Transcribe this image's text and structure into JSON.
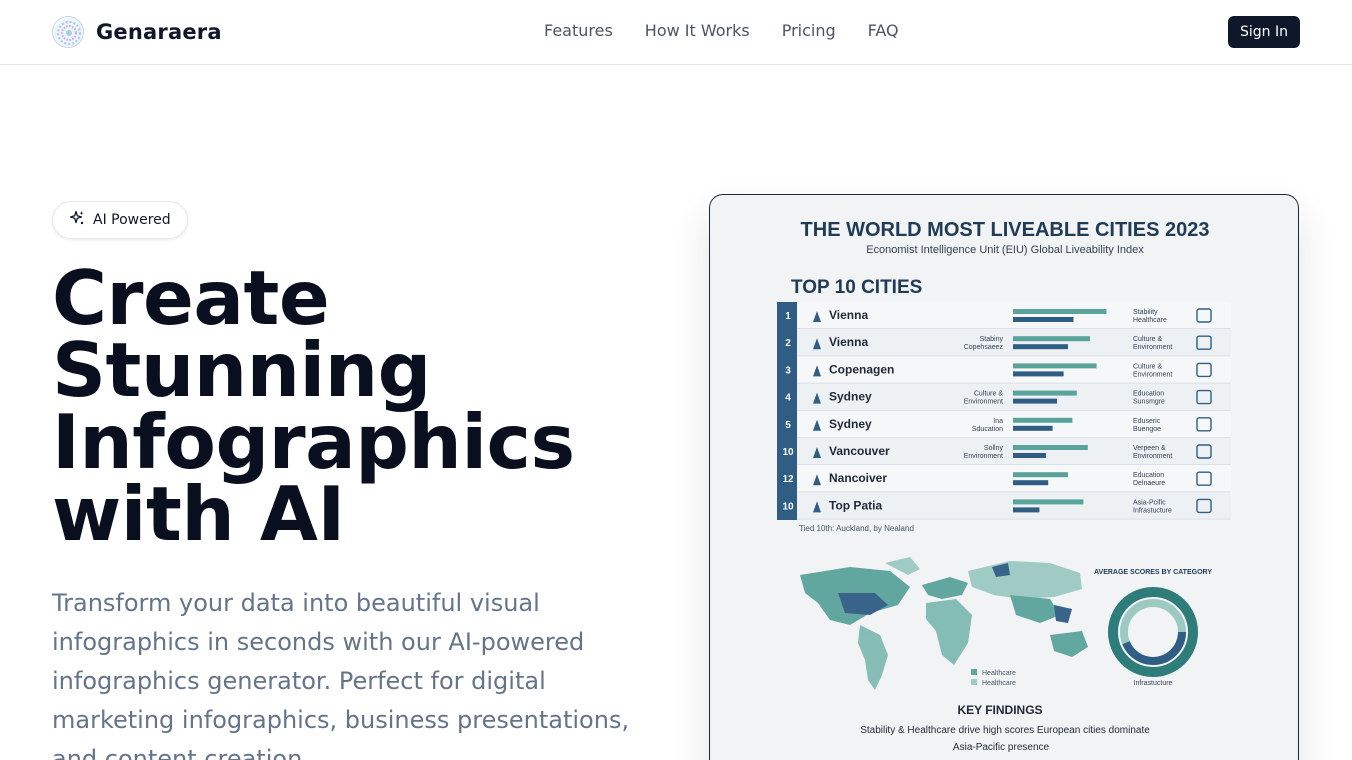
{
  "header": {
    "brand": "Genaraera",
    "nav": [
      "Features",
      "How It Works",
      "Pricing",
      "FAQ"
    ],
    "signin": "Sign In"
  },
  "hero": {
    "badge": "AI Powered",
    "title_lines": [
      "Create",
      "Stunning",
      "Infographics",
      "with AI"
    ],
    "description": "Transform your data into beautiful visual infographics in seconds with our AI-powered infographics generator. Perfect for digital marketing infographics, business presentations, and content creation."
  },
  "infographic": {
    "title": "THE WORLD MOST LIVEABLE CITIES 2023",
    "subtitle": "Economist Intelligence Unit (EIU) Global Liveability Index",
    "section": "TOP 10 CITIES",
    "rows": [
      {
        "rank": "1",
        "city": "Vienna",
        "left": [
          "",
          ""
        ],
        "right": [
          "Stability",
          "Healthcare"
        ],
        "bar1": 0.85,
        "bar2": 0.55
      },
      {
        "rank": "2",
        "city": "Vienna",
        "left": [
          "Stabiny",
          "Copehsaeez"
        ],
        "right": [
          "Culture &",
          "Environment"
        ],
        "bar1": 0.7,
        "bar2": 0.5
      },
      {
        "rank": "3",
        "city": "Copenagen",
        "left": [
          "",
          ""
        ],
        "right": [
          "Culture &",
          "Environment"
        ],
        "bar1": 0.76,
        "bar2": 0.46
      },
      {
        "rank": "4",
        "city": "Sydney",
        "left": [
          "Culture &",
          "Environment"
        ],
        "right": [
          "Education",
          "Sunsmgre"
        ],
        "bar1": 0.58,
        "bar2": 0.4
      },
      {
        "rank": "5",
        "city": "Sydney",
        "left": [
          "Ina",
          "Sducation"
        ],
        "right": [
          "Eduseric",
          "Buengoe"
        ],
        "bar1": 0.54,
        "bar2": 0.36
      },
      {
        "rank": "10",
        "city": "Vancouver",
        "left": [
          "Sollny",
          "Environment"
        ],
        "right": [
          "Verpeen &",
          "Environment"
        ],
        "bar1": 0.68,
        "bar2": 0.3
      },
      {
        "rank": "12",
        "city": "Nancoiver",
        "left": [
          "",
          ""
        ],
        "right": [
          "Education",
          "Delnaeure"
        ],
        "bar1": 0.5,
        "bar2": 0.32
      },
      {
        "rank": "10",
        "city": "Top Patia",
        "left": [
          "",
          ""
        ],
        "right": [
          "Asia-Pcific",
          "Infrastucture"
        ],
        "bar1": 0.64,
        "bar2": 0.24
      }
    ],
    "footnote": "Tied 10th: Auckland, by Nealand",
    "avg_title": "AVERAGE SCORES BY CATEGORY",
    "donut_label": "Infrastucture",
    "legend": [
      "Healthcare",
      "Healthcare"
    ],
    "findings_title": "KEY FINDINGS",
    "findings": [
      "Stability & Healthcare drive high scores  European cities dominate",
      "Asia-Pacific presence"
    ]
  },
  "colors": {
    "primary": "#0f172a",
    "muted": "#64748b",
    "teal": "#5aa39b",
    "navy": "#2f4f6f"
  }
}
